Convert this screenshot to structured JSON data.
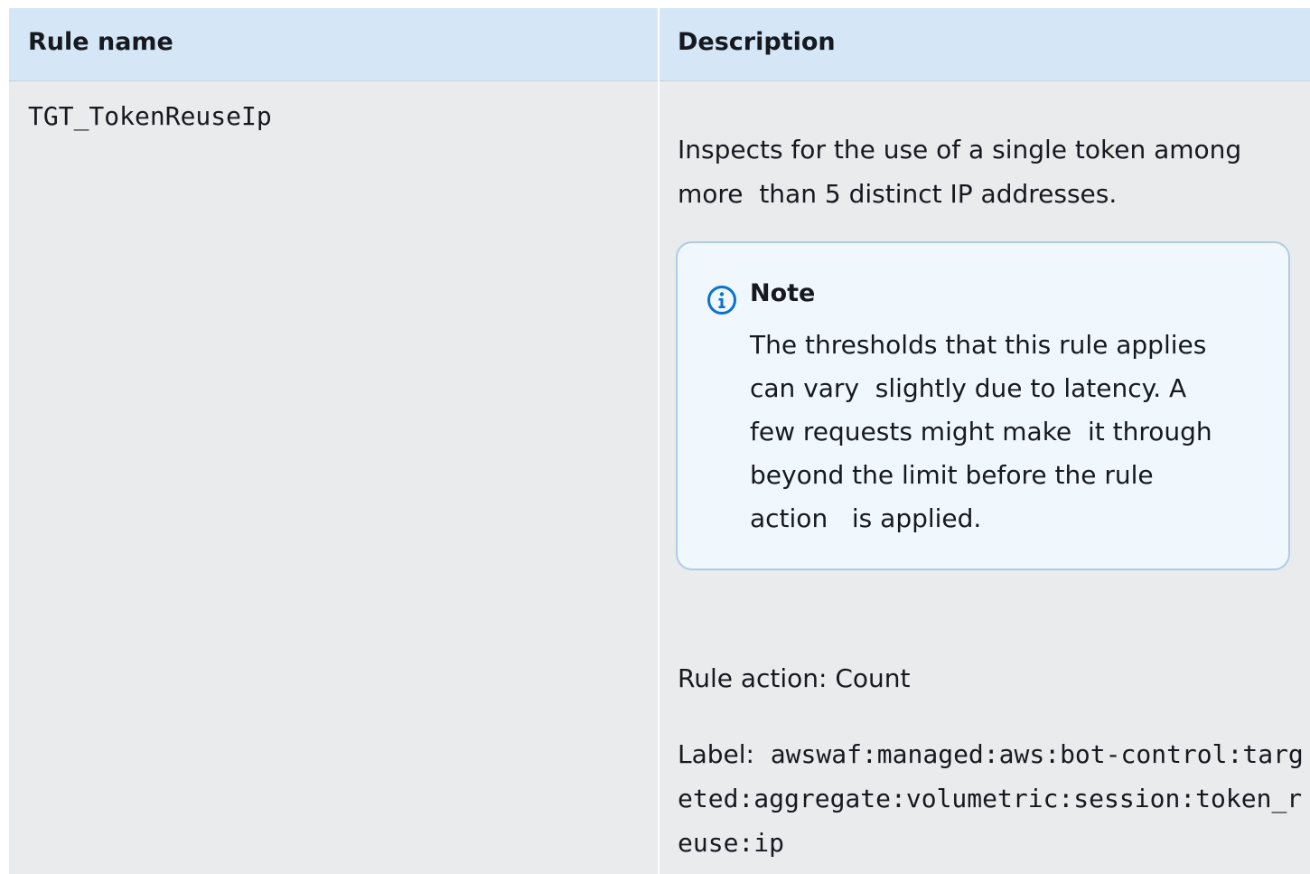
{
  "table": {
    "headers": {
      "rule_name": "Rule name",
      "description": "Description"
    },
    "row": {
      "rule_name": "TGT_TokenReuseIp",
      "description": "Inspects for the use of a single token among\nmore  than 5 distinct IP addresses.",
      "note": {
        "title": "Note",
        "icon": "info-icon",
        "body": "The thresholds that this rule applies\ncan vary  slightly due to latency. A\nfew requests might make  it through\nbeyond the limit before the rule\naction   is applied."
      },
      "rule_action": "Rule action: Count",
      "label_prefix": "Label:  ",
      "label_value": "awswaf:managed:aws:bot-control:targeted:aggregate:volumetric:session:token_reuse:ip"
    }
  },
  "colors": {
    "header_background": "#d5e6f7",
    "cell_background": "#e9ebed",
    "note_background": "#f0f7fd",
    "note_border": "#aecbe9",
    "info_icon": "#0972d3"
  }
}
